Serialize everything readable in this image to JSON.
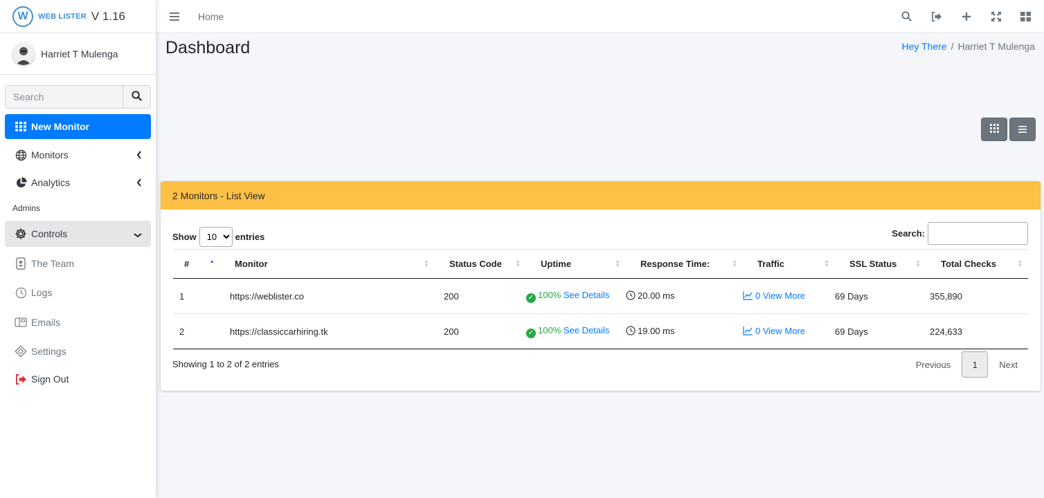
{
  "brand": {
    "logo_letter": "W",
    "name": "WEB LISTER",
    "version": "V 1.16"
  },
  "user": {
    "name": "Harriet T Mulenga"
  },
  "sidebar": {
    "search_placeholder": "Search",
    "primary": [
      {
        "label": "New Monitor",
        "icon": "grid-icon"
      },
      {
        "label": "Monitors",
        "icon": "globe-icon"
      },
      {
        "label": "Analytics",
        "icon": "pie-chart-icon"
      }
    ],
    "admin_header": "Admins",
    "admin_items": [
      {
        "label": "Controls",
        "icon": "gear-icon"
      },
      {
        "label": "The Team",
        "icon": "id-badge-icon"
      },
      {
        "label": "Logs",
        "icon": "clock-icon"
      },
      {
        "label": "Emails",
        "icon": "mail-icon"
      },
      {
        "label": "Settings",
        "icon": "diamond-icon"
      },
      {
        "label": "Sign Out",
        "icon": "sign-out-icon"
      }
    ]
  },
  "topbar": {
    "home_label": "Home",
    "icons": [
      "search-icon",
      "sign-out-icon",
      "plus-icon",
      "expand-icon",
      "apps-icon"
    ]
  },
  "page": {
    "title": "Dashboard",
    "breadcrumb": {
      "link": "Hey There",
      "current": "Harriet T Mulenga"
    }
  },
  "card": {
    "title": "2 Monitors - List View",
    "show_label": "Show",
    "entries_label": "entries",
    "page_length": "10",
    "search_label": "Search:",
    "columns": [
      "#",
      "Monitor",
      "Status Code",
      "Uptime",
      "Response Time:",
      "Traffic",
      "SSL Status",
      "Total Checks"
    ],
    "rows": [
      {
        "num": "1",
        "monitor": "https://weblister.co",
        "status": "200",
        "uptime": "100%",
        "uptime_link": "See Details",
        "response": "20.00 ms",
        "traffic": "0 View More",
        "ssl": "69 Days",
        "checks": "355,890"
      },
      {
        "num": "2",
        "monitor": "https://classiccarhiring.tk",
        "status": "200",
        "uptime": "100%",
        "uptime_link": "See Details",
        "response": "19.00 ms",
        "traffic": "0 View More",
        "ssl": "69 Days",
        "checks": "224,633"
      }
    ],
    "info": "Showing 1 to 2 of 2 entries",
    "pager": {
      "previous": "Previous",
      "current": "1",
      "next": "Next"
    }
  },
  "colors": {
    "accent": "#007bff",
    "card_header": "#ffc046",
    "success": "#28a745",
    "sign_out": "#dc3545"
  }
}
